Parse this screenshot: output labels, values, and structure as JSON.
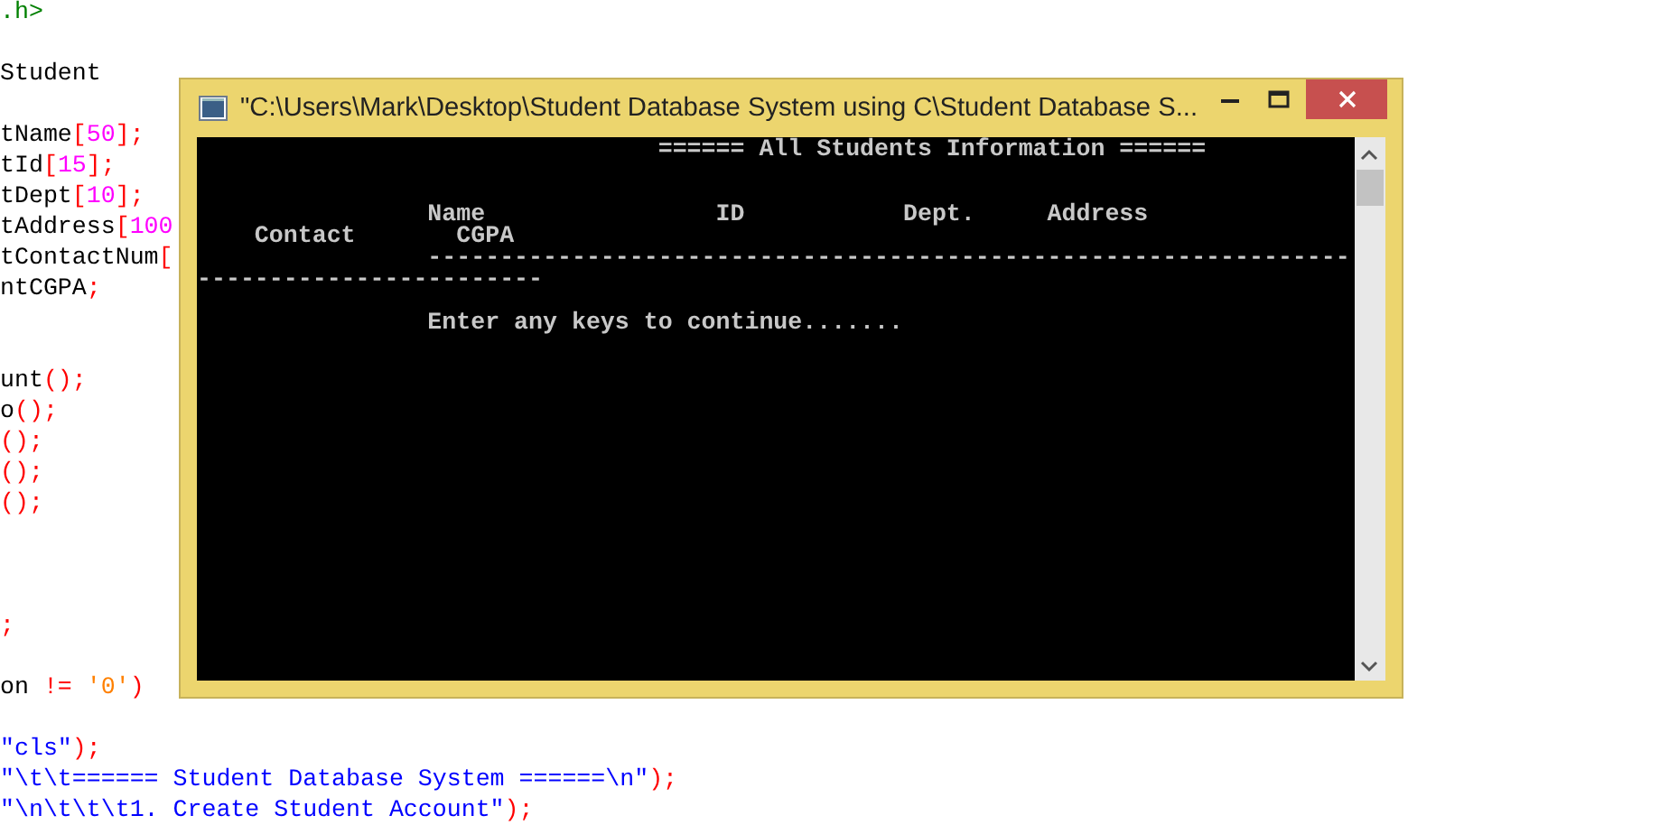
{
  "editor": {
    "lines": [
      {
        "kind": "code",
        "segments": [
          {
            "kind": "include",
            "text": ".h>"
          }
        ]
      },
      {
        "kind": "blank"
      },
      {
        "kind": "code",
        "segments": [
          {
            "kind": "plain",
            "text": "Student"
          }
        ]
      },
      {
        "kind": "blank"
      },
      {
        "kind": "code",
        "segments": [
          {
            "kind": "plain",
            "text": "tName"
          },
          {
            "kind": "punct",
            "text": "["
          },
          {
            "kind": "number",
            "text": "50"
          },
          {
            "kind": "punct",
            "text": "];"
          }
        ]
      },
      {
        "kind": "code",
        "segments": [
          {
            "kind": "plain",
            "text": "tId"
          },
          {
            "kind": "punct",
            "text": "["
          },
          {
            "kind": "number",
            "text": "15"
          },
          {
            "kind": "punct",
            "text": "];"
          }
        ]
      },
      {
        "kind": "code",
        "segments": [
          {
            "kind": "plain",
            "text": "tDept"
          },
          {
            "kind": "punct",
            "text": "["
          },
          {
            "kind": "number",
            "text": "10"
          },
          {
            "kind": "punct",
            "text": "];"
          }
        ]
      },
      {
        "kind": "code",
        "segments": [
          {
            "kind": "plain",
            "text": "tAddress"
          },
          {
            "kind": "punct",
            "text": "["
          },
          {
            "kind": "number",
            "text": "100"
          }
        ]
      },
      {
        "kind": "code",
        "segments": [
          {
            "kind": "plain",
            "text": "tContactNum"
          },
          {
            "kind": "punct",
            "text": "["
          }
        ]
      },
      {
        "kind": "code",
        "segments": [
          {
            "kind": "plain",
            "text": "ntCGPA"
          },
          {
            "kind": "punct",
            "text": ";"
          }
        ]
      },
      {
        "kind": "blank"
      },
      {
        "kind": "blank"
      },
      {
        "kind": "code",
        "segments": [
          {
            "kind": "plain",
            "text": "unt"
          },
          {
            "kind": "punct",
            "text": "();"
          }
        ]
      },
      {
        "kind": "code",
        "segments": [
          {
            "kind": "plain",
            "text": "o"
          },
          {
            "kind": "punct",
            "text": "();"
          }
        ]
      },
      {
        "kind": "code",
        "segments": [
          {
            "kind": "punct",
            "text": "();"
          }
        ]
      },
      {
        "kind": "code",
        "segments": [
          {
            "kind": "punct",
            "text": "();"
          }
        ]
      },
      {
        "kind": "code",
        "segments": [
          {
            "kind": "punct",
            "text": "();"
          }
        ]
      },
      {
        "kind": "blank"
      },
      {
        "kind": "blank"
      },
      {
        "kind": "blank"
      },
      {
        "kind": "code",
        "segments": [
          {
            "kind": "punct",
            "text": ";"
          }
        ]
      },
      {
        "kind": "blank"
      },
      {
        "kind": "code",
        "segments": [
          {
            "kind": "plain",
            "text": "on "
          },
          {
            "kind": "punct",
            "text": "!="
          },
          {
            "kind": "char",
            "text": " '0'"
          },
          {
            "kind": "punct",
            "text": ")"
          }
        ]
      },
      {
        "kind": "blank"
      },
      {
        "kind": "code",
        "segments": [
          {
            "kind": "string",
            "text": "\"cls\""
          },
          {
            "kind": "punct",
            "text": ");"
          }
        ]
      },
      {
        "kind": "code",
        "segments": [
          {
            "kind": "string",
            "text": "\"\\t\\t====== Student Database System ======\\n\""
          },
          {
            "kind": "punct",
            "text": ");"
          }
        ]
      },
      {
        "kind": "code",
        "segments": [
          {
            "kind": "string",
            "text": "\"\\n\\t\\t\\t1. Create Student Account\""
          },
          {
            "kind": "punct",
            "text": ");"
          }
        ]
      }
    ]
  },
  "console_window": {
    "title": "\"C:\\Users\\Mark\\Desktop\\Student Database System using C\\Student Database S...",
    "output": "                                ====== All Students Information ======\n\n\n                Name                ID           Dept.     Address\n    Contact       CGPA\n                ----------------------------------------------------------------\n------------------------\n\n                Enter any keys to continue......."
  }
}
